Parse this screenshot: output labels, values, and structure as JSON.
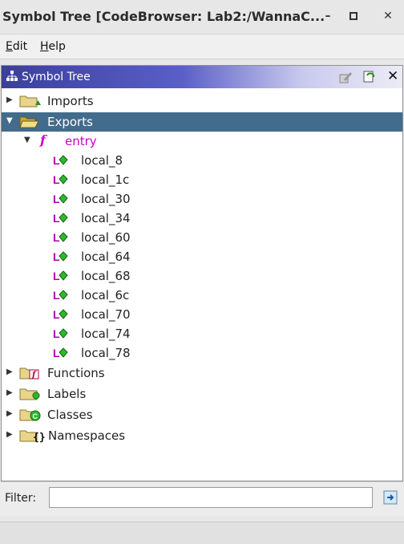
{
  "window": {
    "title": "Symbol Tree [CodeBrowser: Lab2:/WannaC...",
    "minimize": "–",
    "maximize": "◻",
    "close": "✕"
  },
  "menu": [
    {
      "key": "E",
      "rest": "dit"
    },
    {
      "key": "H",
      "rest": "elp"
    }
  ],
  "panel": {
    "title": "Symbol Tree",
    "close": "✕"
  },
  "tree": {
    "imports": "Imports",
    "exports": "Exports",
    "entry": "entry",
    "locals": [
      "local_8",
      "local_1c",
      "local_30",
      "local_34",
      "local_60",
      "local_64",
      "local_68",
      "local_6c",
      "local_70",
      "local_74",
      "local_78"
    ],
    "functions": "Functions",
    "labels": "Labels",
    "classes": "Classes",
    "namespaces": "Namespaces"
  },
  "filter": {
    "label": "Filter:",
    "value": ""
  },
  "colors": {
    "selection": "#426b8c",
    "function": "#cc00cc",
    "header_start": "#3b3f9b"
  }
}
